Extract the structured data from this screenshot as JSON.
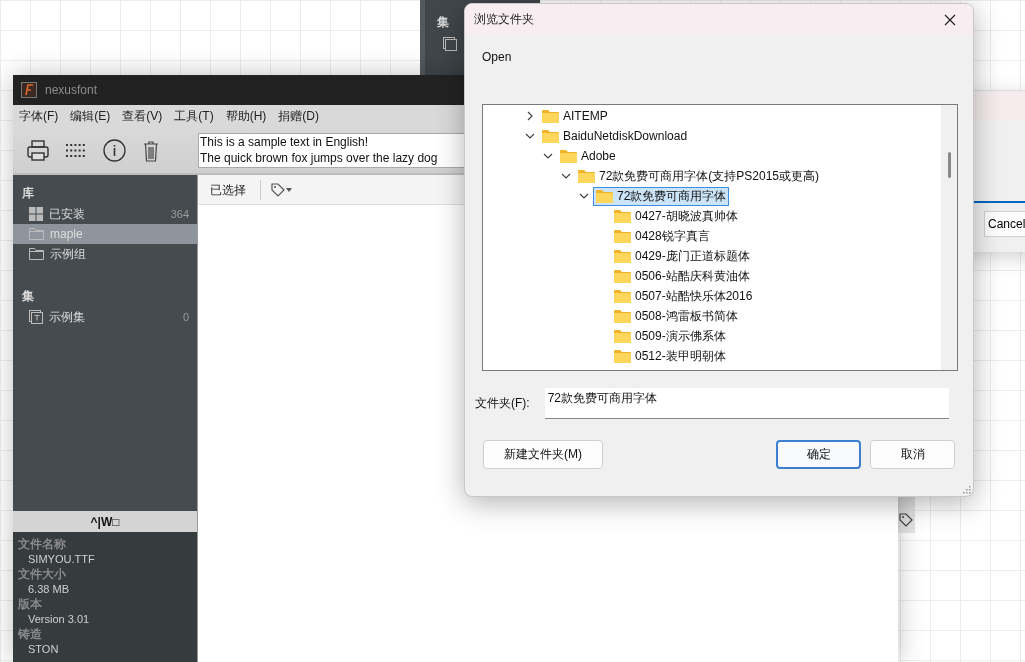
{
  "back_window": {
    "section": "集"
  },
  "right_window": {
    "button": "Cancel"
  },
  "main_window": {
    "title": "nexusfont",
    "menu": [
      "字体(F)",
      "编辑(E)",
      "查看(V)",
      "工具(T)",
      "帮助(H)",
      "捐赠(D)"
    ],
    "sample_text": [
      "This is a sample text in English!",
      "The quick brown fox jumps over the lazy dog"
    ],
    "sidebar": {
      "sections": [
        {
          "title": "库",
          "items": [
            {
              "kind": "installed",
              "label": "已安装",
              "count": "364",
              "selected": false
            },
            {
              "kind": "folder",
              "label": "maple",
              "selected": true
            },
            {
              "kind": "folder",
              "label": "示例组",
              "selected": false
            }
          ]
        },
        {
          "title": "集",
          "items": [
            {
              "kind": "collection",
              "label": "示例集",
              "count": "0",
              "selected": false
            }
          ]
        }
      ]
    },
    "info": {
      "header": "^|W□",
      "fields": [
        {
          "label": "文件名称",
          "value": "SIMYOU.TTF"
        },
        {
          "label": "文件大小",
          "value": "6.38 MB"
        },
        {
          "label": "版本",
          "value": "Version 3.01"
        },
        {
          "label": "铸造",
          "value": "STON"
        }
      ]
    },
    "content_toolbar": {
      "selected_label": "已选择"
    }
  },
  "dialog": {
    "title": "浏览文件夹",
    "prompt": "Open",
    "tree": [
      {
        "label": "AITEMP",
        "expanded": false,
        "selected": false
      },
      {
        "label": "BaiduNetdiskDownload",
        "expanded": true,
        "selected": false,
        "children": [
          {
            "label": "Adobe",
            "expanded": true,
            "selected": false,
            "children": [
              {
                "label": "72款免费可商用字体(支持PS2015或更高)",
                "expanded": true,
                "selected": false,
                "children": [
                  {
                    "label": "72款免费可商用字体",
                    "expanded": true,
                    "selected": true,
                    "children": [
                      {
                        "label": "0427-胡晓波真帅体",
                        "selected": false
                      },
                      {
                        "label": "0428锐字真言",
                        "selected": false
                      },
                      {
                        "label": "0429-庞门正道标题体",
                        "selected": false
                      },
                      {
                        "label": "0506-站酷庆科黄油体",
                        "selected": false
                      },
                      {
                        "label": "0507-站酷快乐体2016",
                        "selected": false
                      },
                      {
                        "label": "0508-鸿雷板书简体",
                        "selected": false
                      },
                      {
                        "label": "0509-演示佛系体",
                        "selected": false
                      },
                      {
                        "label": "0512-装甲明朝体",
                        "selected": false
                      }
                    ]
                  }
                ]
              }
            ]
          }
        ]
      }
    ],
    "folder_label": "文件夹(F):",
    "folder_value": "72款免费可商用字体",
    "buttons": [
      {
        "label": "新建文件夹(M)",
        "default": false
      },
      {
        "label": "确定",
        "default": true
      },
      {
        "label": "取消",
        "default": false
      }
    ]
  }
}
